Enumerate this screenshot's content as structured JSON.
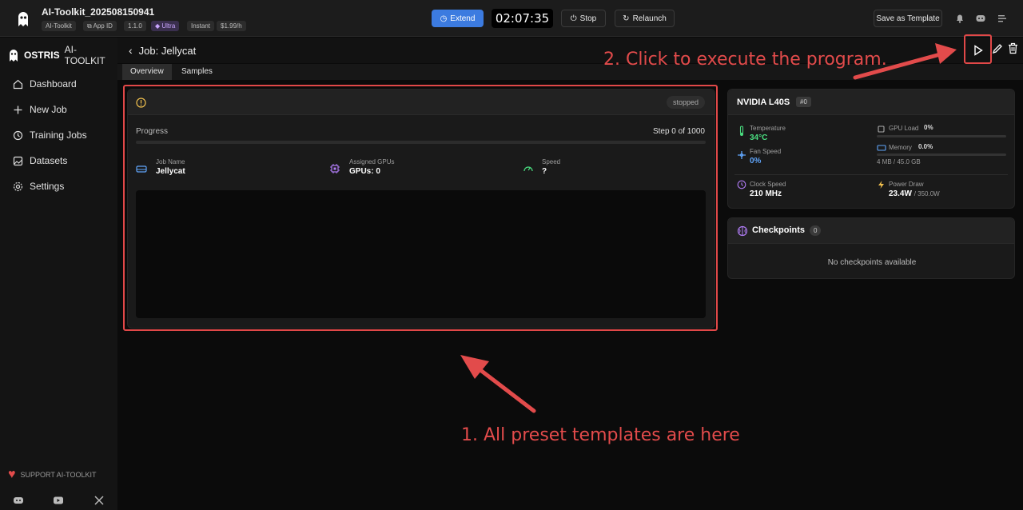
{
  "header": {
    "app_title": "AI-Toolkit_202508150941",
    "pills": [
      "AI-Toolkit",
      "App ID",
      "1.1.0",
      "Ultra",
      "Instant",
      "$1.99/h"
    ],
    "extend_label": "Extend",
    "timer": "02:07:35",
    "stop_label": "Stop",
    "relaunch_label": "Relaunch",
    "save_template_label": "Save as Template"
  },
  "sidebar": {
    "brand_bold": "OSTRIS",
    "brand_rest": "AI-TOOLKIT",
    "items": [
      {
        "label": "Dashboard",
        "icon": "home-icon"
      },
      {
        "label": "New Job",
        "icon": "plus-icon"
      },
      {
        "label": "Training Jobs",
        "icon": "training-icon"
      },
      {
        "label": "Datasets",
        "icon": "images-icon"
      },
      {
        "label": "Settings",
        "icon": "gear-icon"
      }
    ],
    "support_label": "SUPPORT AI-TOOLKIT"
  },
  "job": {
    "title": "Job: Jellycat",
    "tabs": [
      "Overview",
      "Samples"
    ],
    "status": "stopped",
    "progress_label": "Progress",
    "progress_text": "Step 0 of 1000",
    "progress_fraction": 0,
    "job_name_label": "Job Name",
    "job_name": "Jellycat",
    "gpus_label": "Assigned GPUs",
    "gpus_value": "GPUs: 0",
    "speed_label": "Speed",
    "speed_value": "?"
  },
  "gpu": {
    "name": "NVIDIA L40S",
    "index": "#0",
    "temperature_label": "Temperature",
    "temperature": "34°C",
    "fan_label": "Fan Speed",
    "fan": "0%",
    "gpu_load_label": "GPU Load",
    "gpu_load": "0%",
    "memory_label": "Memory",
    "memory": "0.0%",
    "memory_detail": "4 MB / 45.0 GB",
    "clock_label": "Clock Speed",
    "clock": "210 MHz",
    "power_label": "Power Draw",
    "power": "23.4W",
    "power_max": "/ 350.0W"
  },
  "checkpoints": {
    "title": "Checkpoints",
    "count": "0",
    "empty_text": "No checkpoints available"
  },
  "annotations": {
    "step1": "1. All preset templates are here",
    "step2": "2. Click to execute the program."
  },
  "colors": {
    "accent_blue": "#3c7be0",
    "annotation_red": "#e24b4b",
    "temp_green": "#4ade80",
    "fan_blue": "#60a5fa",
    "ultra_purple": "#c9a5ff"
  }
}
